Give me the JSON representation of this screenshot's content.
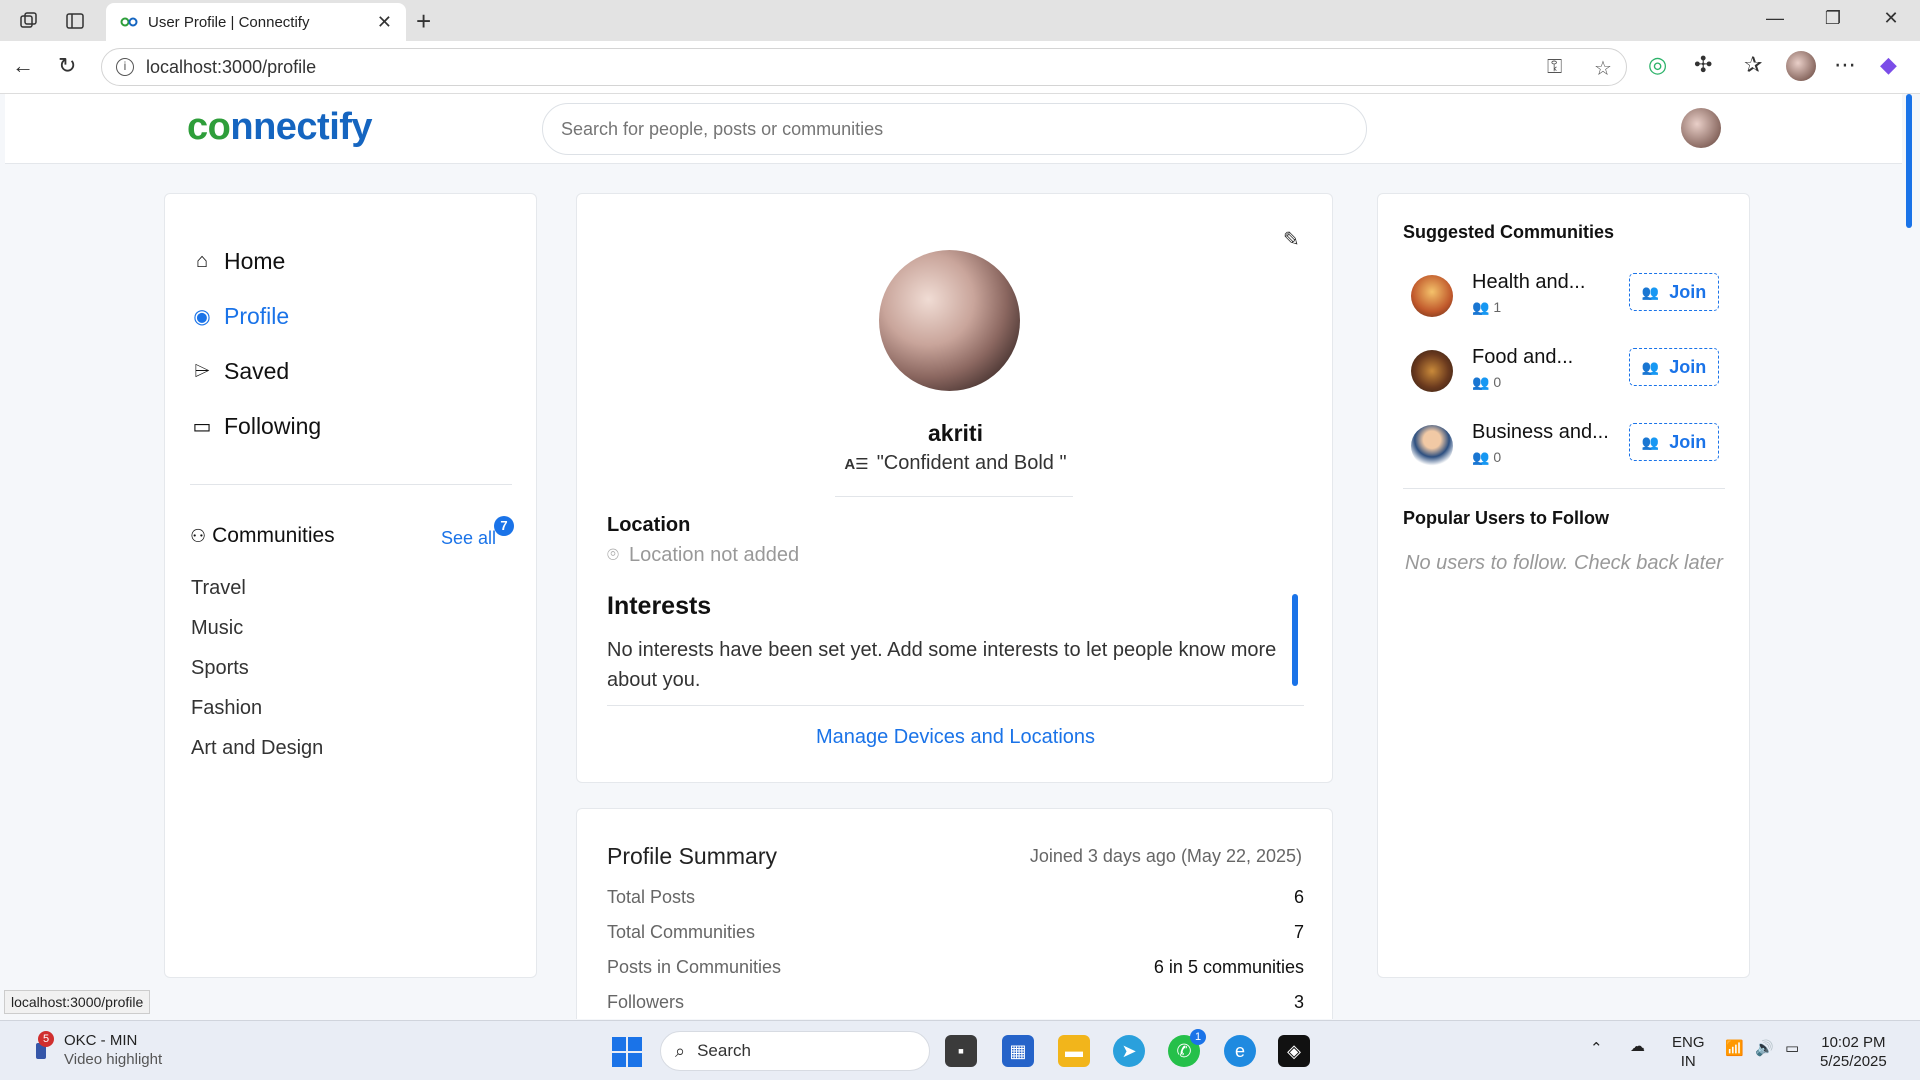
{
  "browser": {
    "tab_title": "User Profile | Connectify",
    "url": "localhost:3000/profile",
    "status_url": "localhost:3000/profile"
  },
  "header": {
    "logo_part1": "co",
    "logo_part2": "nnectify",
    "search_placeholder": "Search for people, posts or communities"
  },
  "sidebar": {
    "nav": [
      {
        "label": "Home",
        "icon": "home-icon"
      },
      {
        "label": "Profile",
        "icon": "user-circle-icon",
        "active": true
      },
      {
        "label": "Saved",
        "icon": "tag-icon"
      },
      {
        "label": "Following",
        "icon": "stack-icon"
      }
    ],
    "communities_label": "Communities",
    "see_all": "See all",
    "communities_count": "7",
    "communities": [
      "Travel",
      "Music",
      "Sports",
      "Fashion",
      "Art and Design"
    ]
  },
  "profile": {
    "username": "akriti",
    "bio": "\"Confident and Bold \"",
    "location_label": "Location",
    "location_value": "Location not added",
    "interests_label": "Interests",
    "interests_value": "No interests have been set yet. Add some interests to let people know more about you.",
    "manage_link": "Manage Devices and Locations"
  },
  "summary": {
    "title": "Profile Summary",
    "joined": "Joined 3 days ago (May 22, 2025)",
    "rows": [
      {
        "label": "Total Posts",
        "value": "6"
      },
      {
        "label": "Total Communities",
        "value": "7"
      },
      {
        "label": "Posts in Communities",
        "value": "6 in 5 communities"
      },
      {
        "label": "Followers",
        "value": "3"
      }
    ]
  },
  "suggested": {
    "title": "Suggested Communities",
    "items": [
      {
        "name": "Health and...",
        "members": "1",
        "join": "Join"
      },
      {
        "name": "Food and...",
        "members": "0",
        "join": "Join"
      },
      {
        "name": "Business and...",
        "members": "0",
        "join": "Join"
      }
    ]
  },
  "popular": {
    "title": "Popular Users to Follow",
    "empty": "No users to follow. Check back later"
  },
  "taskbar": {
    "notif_count": "5",
    "app_title": "OKC - MIN",
    "app_sub": "Video highlight",
    "search": "Search",
    "whatsapp_badge": "1",
    "lang1": "ENG",
    "lang2": "IN",
    "time": "10:02 PM",
    "date": "5/25/2025"
  },
  "colors": {
    "accent": "#1a73e8",
    "logo_green": "#2e9e3a",
    "logo_blue": "#1565c0"
  }
}
